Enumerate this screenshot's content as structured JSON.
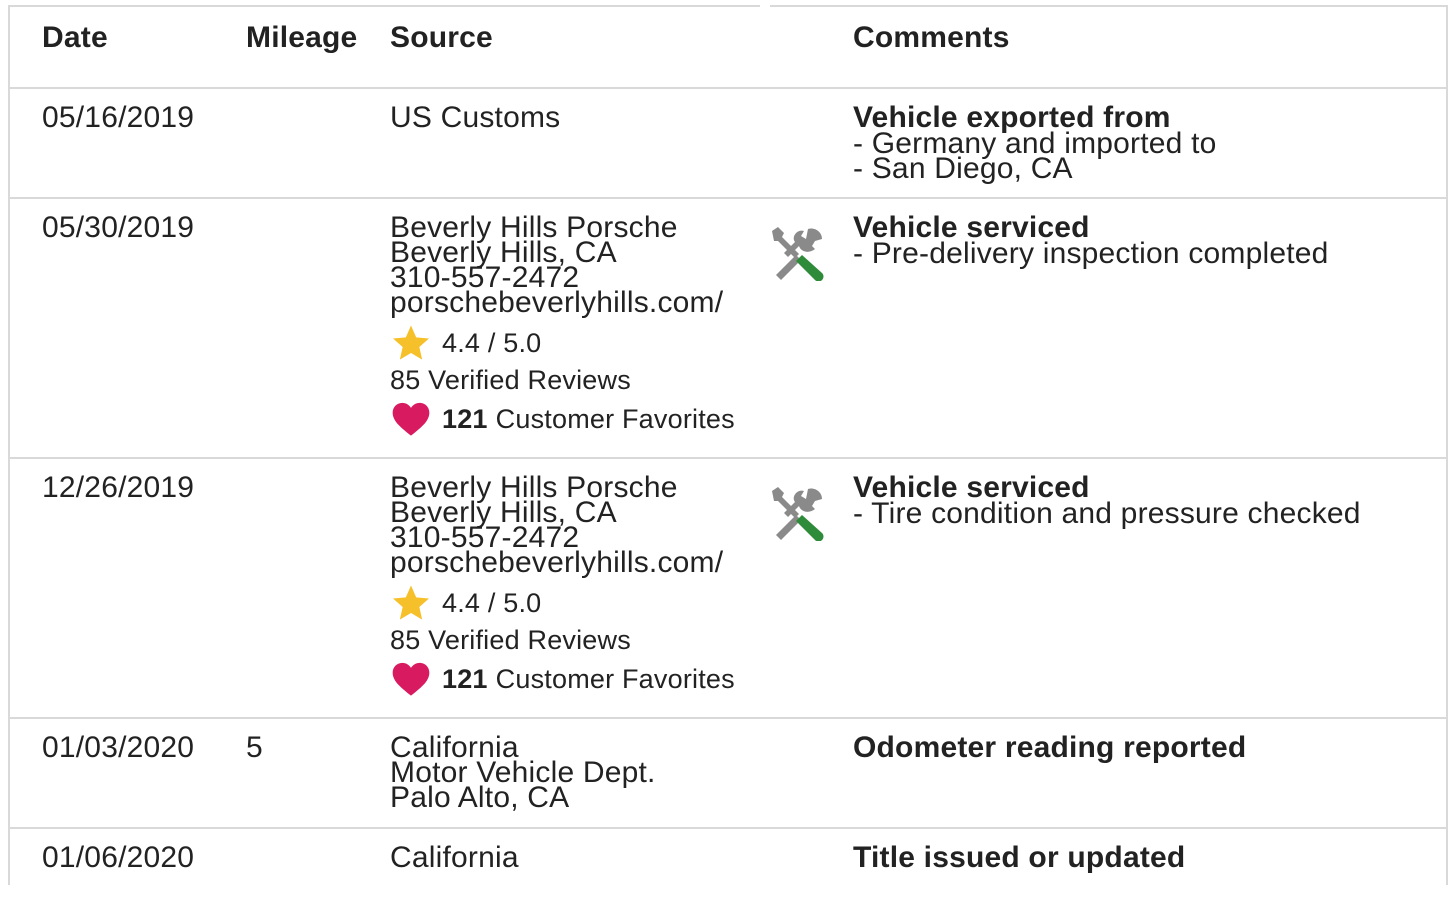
{
  "headers": {
    "date": "Date",
    "mileage": "Mileage",
    "source": "Source",
    "comments": "Comments"
  },
  "rows": [
    {
      "date": "05/16/2019",
      "mileage": "",
      "source": [
        "US Customs"
      ],
      "comment_title": "Vehicle exported from",
      "comment_lines": [
        "- Germany and imported to",
        "- San Diego, CA"
      ]
    },
    {
      "date": "05/30/2019",
      "mileage": "",
      "source": [
        "Beverly Hills Porsche",
        "Beverly Hills, CA",
        "310-557-2472",
        "porschebeverlyhills.com/"
      ],
      "rating": "4.4 / 5.0",
      "reviews": "85 Verified Reviews",
      "favorites_count": "121",
      "favorites_label": "Customer Favorites",
      "icon": "service-tools-icon",
      "comment_title": "Vehicle serviced",
      "comment_lines": [
        "- Pre-delivery inspection completed"
      ]
    },
    {
      "date": "12/26/2019",
      "mileage": "",
      "source": [
        "Beverly Hills Porsche",
        "Beverly Hills, CA",
        "310-557-2472",
        "porschebeverlyhills.com/"
      ],
      "rating": "4.4 / 5.0",
      "reviews": "85 Verified Reviews",
      "favorites_count": "121",
      "favorites_label": "Customer Favorites",
      "icon": "service-tools-icon",
      "comment_title": "Vehicle serviced",
      "comment_lines": [
        "- Tire condition and pressure checked"
      ]
    },
    {
      "date": "01/03/2020",
      "mileage": "5",
      "source": [
        "California",
        "Motor Vehicle Dept.",
        "Palo Alto, CA"
      ],
      "comment_title": "Odometer reading reported",
      "comment_lines": []
    },
    {
      "date": "01/06/2020",
      "mileage": "",
      "source": [
        "California"
      ],
      "comment_title": "Title issued or updated",
      "comment_lines": []
    }
  ],
  "colors": {
    "star": "#f6c02a",
    "heart": "#d81b60",
    "tool_gray": "#8a8a8a",
    "tool_green": "#2e8b3a",
    "border": "#d9d9d9"
  }
}
